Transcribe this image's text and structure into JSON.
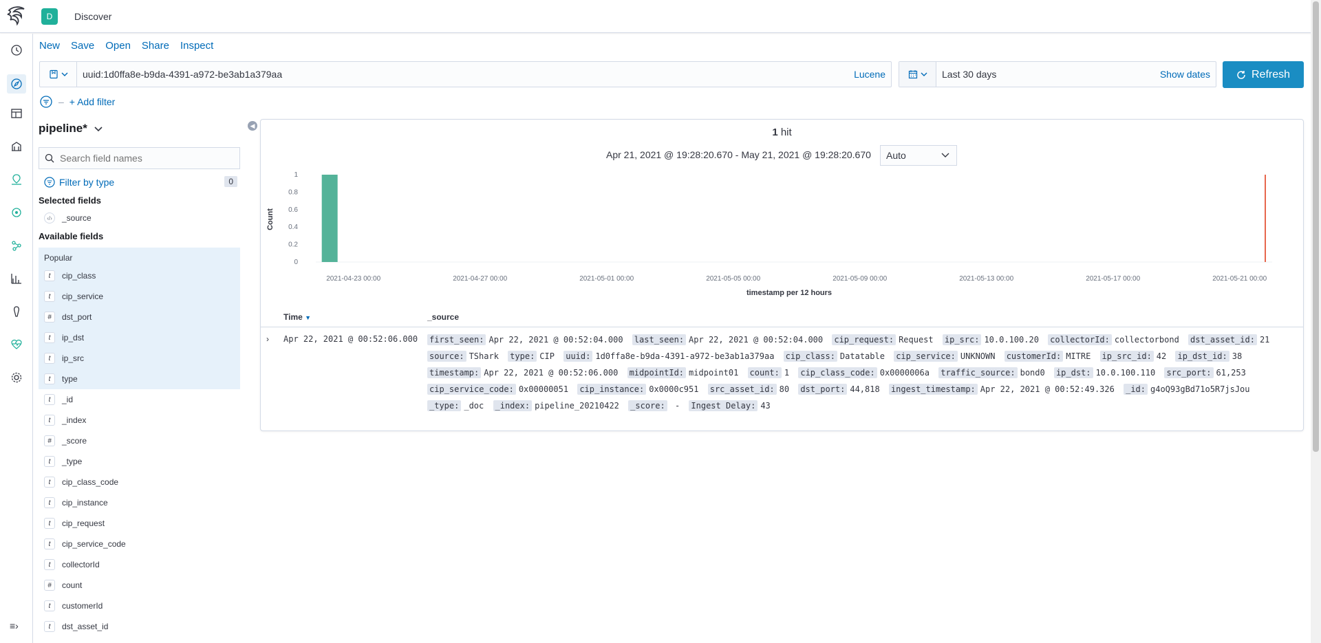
{
  "topbar": {
    "space_initial": "D",
    "app_title": "Discover"
  },
  "menu": [
    "New",
    "Save",
    "Open",
    "Share",
    "Inspect"
  ],
  "query": {
    "value": "uuid:1d0ffa8e-b9da-4391-a972-be3ab1a379aa",
    "language": "Lucene"
  },
  "date": {
    "range": "Last 30 days",
    "show_dates": "Show dates",
    "refresh": "Refresh"
  },
  "filters": {
    "add_filter": "+ Add filter"
  },
  "sidebar": {
    "index_pattern": "pipeline*",
    "search_placeholder": "Search field names",
    "filter_by_type": "Filter by type",
    "filter_count": "0",
    "selected_title": "Selected fields",
    "selected_fields": [
      {
        "type": "source",
        "name": "_source"
      }
    ],
    "available_title": "Available fields",
    "popular_label": "Popular",
    "popular_fields": [
      {
        "type": "t",
        "name": "cip_class"
      },
      {
        "type": "t",
        "name": "cip_service"
      },
      {
        "type": "#",
        "name": "dst_port"
      },
      {
        "type": "t",
        "name": "ip_dst"
      },
      {
        "type": "t",
        "name": "ip_src"
      },
      {
        "type": "t",
        "name": "type"
      }
    ],
    "other_fields": [
      {
        "type": "t",
        "name": "_id"
      },
      {
        "type": "t",
        "name": "_index"
      },
      {
        "type": "#",
        "name": "_score"
      },
      {
        "type": "t",
        "name": "_type"
      },
      {
        "type": "t",
        "name": "cip_class_code"
      },
      {
        "type": "t",
        "name": "cip_instance"
      },
      {
        "type": "t",
        "name": "cip_request"
      },
      {
        "type": "t",
        "name": "cip_service_code"
      },
      {
        "type": "t",
        "name": "collectorId"
      },
      {
        "type": "#",
        "name": "count"
      },
      {
        "type": "t",
        "name": "customerId"
      },
      {
        "type": "t",
        "name": "dst_asset_id"
      }
    ]
  },
  "results": {
    "hit_count": "1",
    "hit_label": "hit",
    "date_range": "Apr 21, 2021 @ 19:28:20.670 - May 21, 2021 @ 19:28:20.670",
    "interval": "Auto",
    "col_time": "Time",
    "col_source": "_source",
    "row_time": "Apr 22, 2021 @ 00:52:06.000",
    "row_source": [
      [
        "first_seen:",
        "Apr 22, 2021 @ 00:52:04.000"
      ],
      [
        "last_seen:",
        "Apr 22, 2021 @ 00:52:04.000"
      ],
      [
        "cip_request:",
        "Request"
      ],
      [
        "ip_src:",
        "10.0.100.20"
      ],
      [
        "collectorId:",
        "collectorbond"
      ],
      [
        "dst_asset_id:",
        "21"
      ],
      [
        "source:",
        "TShark"
      ],
      [
        "type:",
        "CIP"
      ],
      [
        "uuid:",
        "1d0ffa8e-b9da-4391-a972-be3ab1a379aa"
      ],
      [
        "cip_class:",
        "Datatable"
      ],
      [
        "cip_service:",
        "UNKNOWN"
      ],
      [
        "customerId:",
        "MITRE"
      ],
      [
        "ip_src_id:",
        "42"
      ],
      [
        "ip_dst_id:",
        "38"
      ],
      [
        "timestamp:",
        "Apr 22, 2021 @ 00:52:06.000"
      ],
      [
        "midpointId:",
        "midpoint01"
      ],
      [
        "count:",
        "1"
      ],
      [
        "cip_class_code:",
        "0x0000006a"
      ],
      [
        "traffic_source:",
        "bond0"
      ],
      [
        "ip_dst:",
        "10.0.100.110"
      ],
      [
        "src_port:",
        "61,253"
      ],
      [
        "cip_service_code:",
        "0x00000051"
      ],
      [
        "cip_instance:",
        "0x0000c951"
      ],
      [
        "src_asset_id:",
        "80"
      ],
      [
        "dst_port:",
        "44,818"
      ],
      [
        "ingest_timestamp:",
        "Apr 22, 2021 @ 00:52:49.326"
      ],
      [
        "_id:",
        "g4oQ93gBd71o5R7jsJou"
      ],
      [
        "_type:",
        "_doc"
      ],
      [
        "_index:",
        "pipeline_20210422"
      ],
      [
        "_score:",
        " - "
      ],
      [
        "Ingest Delay:",
        "43"
      ]
    ]
  },
  "chart_data": {
    "type": "bar",
    "xlabel": "timestamp per 12 hours",
    "ylabel": "Count",
    "ylim": [
      0,
      1
    ],
    "yticks": [
      "0",
      "0.2",
      "0.4",
      "0.6",
      "0.8",
      "1"
    ],
    "xticks": [
      "2021-04-23 00:00",
      "2021-04-27 00:00",
      "2021-05-01 00:00",
      "2021-05-05 00:00",
      "2021-05-09 00:00",
      "2021-05-13 00:00",
      "2021-05-17 00:00",
      "2021-05-21 00:00"
    ],
    "x": [
      "2021-04-22 00:00"
    ],
    "values": [
      1
    ],
    "bar_color": "#54b399",
    "now_marker_color": "#e7664c"
  }
}
